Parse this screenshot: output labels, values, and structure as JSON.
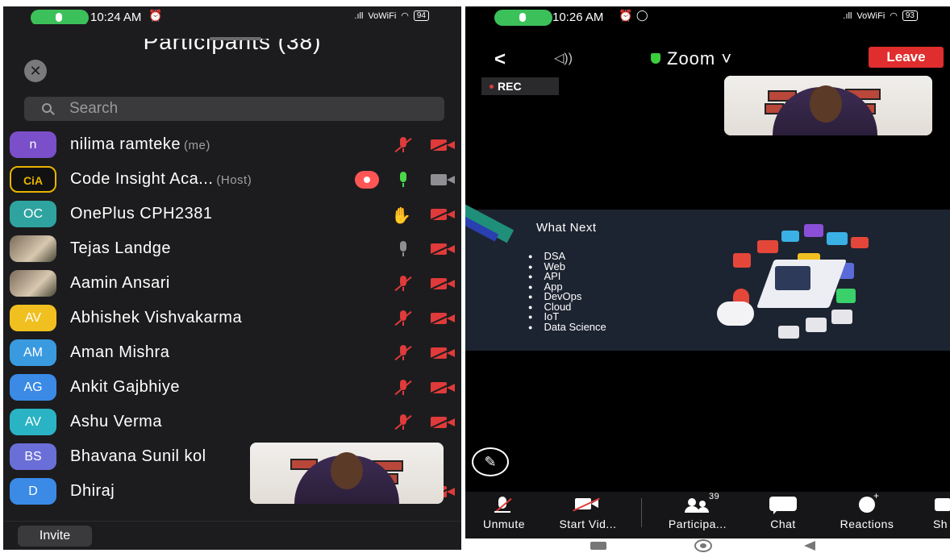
{
  "left": {
    "status": {
      "time": "10:24 AM",
      "signal": ".ıll",
      "network": "VoWiFi",
      "battery": "94"
    },
    "title": "Participants (38)",
    "search_placeholder": "Search",
    "participants": [
      {
        "name": "nilima ramteke",
        "tag": "(me)",
        "initials": "n",
        "color": "#7a4fc9",
        "mic": "muted",
        "video": "off"
      },
      {
        "name": "Code Insight Aca...",
        "tag": "(Host)",
        "initials": "CiA",
        "color": "#111111",
        "mic": "on",
        "video": "on",
        "recording": true
      },
      {
        "name": "OnePlus CPH2381",
        "tag": "",
        "initials": "OC",
        "color": "#2fa3a0",
        "mic": "hand",
        "video": "off"
      },
      {
        "name": "Tejas Landge",
        "tag": "",
        "initials": "",
        "color": "photo",
        "mic": "off",
        "video": "off"
      },
      {
        "name": "Aamin Ansari",
        "tag": "",
        "initials": "",
        "color": "photo",
        "mic": "muted",
        "video": "off"
      },
      {
        "name": "Abhishek Vishvakarma",
        "tag": "",
        "initials": "AV",
        "color": "#f0c020",
        "mic": "muted",
        "video": "off"
      },
      {
        "name": "Aman Mishra",
        "tag": "",
        "initials": "AM",
        "color": "#3a9adf",
        "mic": "muted",
        "video": "off"
      },
      {
        "name": "Ankit Gajbhiye",
        "tag": "",
        "initials": "AG",
        "color": "#3a8ae6",
        "mic": "muted",
        "video": "off"
      },
      {
        "name": "Ashu Verma",
        "tag": "",
        "initials": "AV",
        "color": "#29b3c4",
        "mic": "muted",
        "video": "off"
      },
      {
        "name": "Bhavana Sunil kol",
        "tag": "",
        "initials": "BS",
        "color": "#6a6fd8",
        "mic": "none",
        "video": "none"
      },
      {
        "name": "Dhiraj",
        "tag": "",
        "initials": "D",
        "color": "#3a8ae6",
        "mic": "none",
        "video": "off"
      }
    ],
    "invite_label": "Invite"
  },
  "right": {
    "status": {
      "time": "10:26 AM",
      "signal": ".ıll",
      "network": "VoWiFi",
      "battery": "93"
    },
    "back_glyph": "<",
    "speaker_glyph": "◁))",
    "meeting_title": "Zoom ˅",
    "leave_label": "Leave",
    "rec_label": "REC",
    "slide": {
      "title": "What Next",
      "items": [
        "DSA",
        "Web",
        "API",
        "App",
        "DevOps",
        "Cloud",
        "IoT",
        "Data Science"
      ]
    },
    "pencil_glyph": "✎",
    "toolbar": {
      "unmute": "Unmute",
      "start_video": "Start Vid...",
      "participants": "Participa...",
      "participants_count": "39",
      "chat": "Chat",
      "reactions": "Reactions",
      "share": "Sh"
    }
  }
}
